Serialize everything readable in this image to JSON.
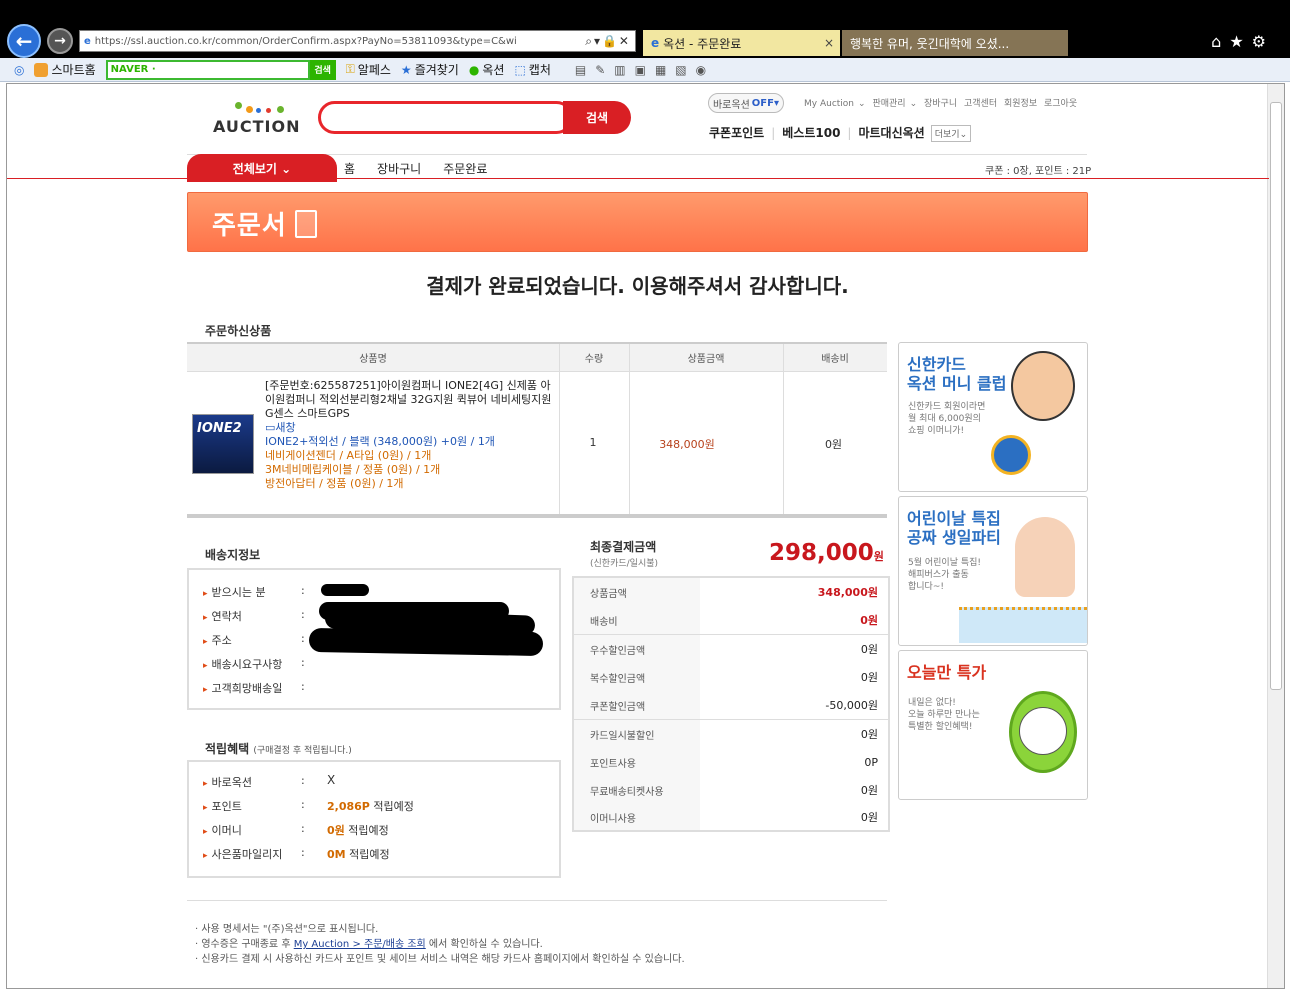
{
  "browser": {
    "url": "https://ssl.auction.co.kr/common/OrderConfirm.aspx?PayNo=53811093&type=C&wi",
    "tabs": [
      {
        "label": "옥션 - 주문완료",
        "close": "×"
      },
      {
        "label": "행복한 유머, 웃긴대학에 오셨..."
      }
    ],
    "toolbar": {
      "home": "스마트홈",
      "naver": "NAVER ·",
      "search_btn": "검색",
      "items": [
        "알페스",
        "즐겨찾기",
        "옥션",
        "캡처"
      ]
    },
    "top_icons": "⌂★⚙"
  },
  "site": {
    "logo": "AUCTION",
    "search_button": "검색",
    "bro_label": "바로옥션",
    "bro_state": "OFF",
    "util_nav": [
      "My Auction",
      "판매관리",
      "장바구니",
      "고객센터",
      "회원정보",
      "로그아웃"
    ],
    "main_nav": [
      "쿠폰포인트",
      "베스트100",
      "마트대신옥션"
    ],
    "more": "더보기",
    "all_button": "전체보기 ⌄",
    "crumbs": [
      "홈",
      "장바구니",
      "주문완료"
    ],
    "coupon_info": "쿠폰 : 0장, 포인트 : 21P"
  },
  "banner": {
    "title": "주문서"
  },
  "thanks": "결제가 완료되었습니다. 이용해주셔서 감사합니다.",
  "order": {
    "heading": "주문하신상품",
    "columns": [
      "상품명",
      "수량",
      "상품금액",
      "배송비"
    ],
    "image_text": "IONE2",
    "name": "[주문번호:625587251]아이원컴퍼니 IONE2[4G] 신제품 아이원컴퍼니 적외선분리형2채널 32G지원 퀵뷰어 네비세팅지원 G센스 스마트GPS",
    "newwin": "새창",
    "option_main": "IONE2+적외선 / 블랙 (348,000원) +0원 / 1개",
    "options": [
      "네비게이션젠더 / A타입 (0원) / 1개",
      "3M네비메립케이블 / 정품 (0원) / 1개",
      "방전아답터 / 정품 (0원) / 1개"
    ],
    "qty": "1",
    "price": "348,000원",
    "shipping": "0원"
  },
  "delivery": {
    "heading": "배송지정보",
    "rows": [
      "받으시는 분",
      "연락처",
      "주소",
      "배송시요구사항",
      "고객희망배송일"
    ],
    "colon": ":"
  },
  "reward": {
    "heading": "적립혜택",
    "note": "(구매결정 후 적립됩니다.)",
    "rows": [
      {
        "label": "바로옥션",
        "value": "X",
        "suffix": ""
      },
      {
        "label": "포인트",
        "value": "2,086P",
        "suffix": "적립예정"
      },
      {
        "label": "이머니",
        "value": "0원",
        "suffix": "적립예정"
      },
      {
        "label": "사은품마일리지",
        "value": "0M",
        "suffix": "적립예정"
      }
    ]
  },
  "final": {
    "heading": "최종결제금액",
    "sub": "(신한카드/일시불)",
    "amount": "298,000",
    "unit": "원",
    "rows": [
      {
        "label": "상품금액",
        "value": "348,000원"
      },
      {
        "label": "배송비",
        "value": "0원"
      },
      {
        "label": "우수할인금액",
        "value": "0원"
      },
      {
        "label": "복수할인금액",
        "value": "0원"
      },
      {
        "label": "쿠폰할인금액",
        "value": "-50,000원"
      },
      {
        "label": "카드일시불할인",
        "value": "0원"
      },
      {
        "label": "포인트사용",
        "value": "0P"
      },
      {
        "label": "무료배송티켓사용",
        "value": "0원"
      },
      {
        "label": "이머니사용",
        "value": "0원"
      }
    ]
  },
  "ads": [
    {
      "title": "신한카드\n옥션 머니 클럽",
      "desc": "신한카드 회원이라면\n월 최대 6,000원의\n쇼핑 이머니가!"
    },
    {
      "title": "어린이날 특집\n공짜 생일파티",
      "desc": "5월 어린이날 특집!\n해피버스가 출동\n합니다~!"
    },
    {
      "title": "오늘만 특가",
      "desc": "내일은 없다!\n오늘 하루만 만나는\n특별한 할인혜택!"
    }
  ],
  "notes": {
    "line1": "· 사용 명세서는 \"(주)옥션\"으로 표시됩니다.",
    "line2_pre": "· 영수증은 구매종료 후 ",
    "line2_link": "My Auction > 주문/배송 조회",
    "line2_post": " 에서 확인하실 수 있습니다.",
    "line3": "· 신용카드 결제 시 사용하신 카드사 포인트 및 세이브 서비스 내역은 해당 카드사 홈페이지에서 확인하실 수 있습니다."
  },
  "colors": {
    "accent": "#d91f24",
    "banner": "#ff7349",
    "highlight": "#d26a00"
  }
}
